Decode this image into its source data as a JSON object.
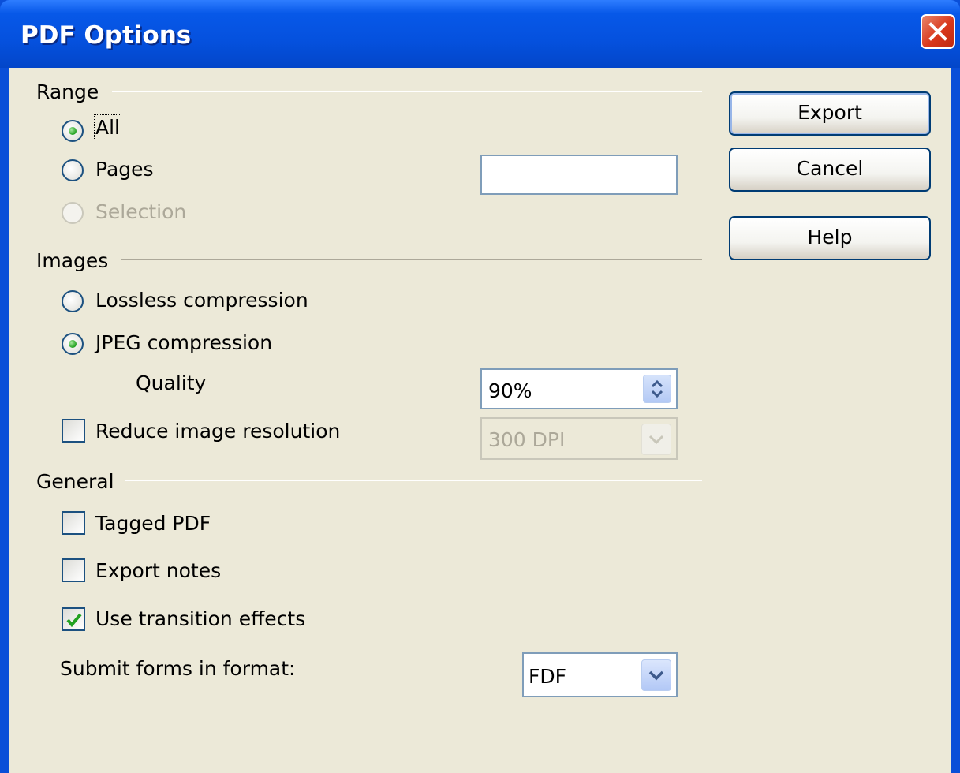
{
  "window": {
    "title": "PDF Options"
  },
  "range": {
    "heading": "Range",
    "all_label": "All",
    "pages_label": "Pages",
    "pages_value": "",
    "selection_label": "Selection",
    "selected": "All"
  },
  "images": {
    "heading": "Images",
    "lossless_label": "Lossless compression",
    "jpeg_label": "JPEG compression",
    "selected": "JPEG compression",
    "quality_label": "Quality",
    "quality_value": "90%",
    "reduce_label": "Reduce image resolution",
    "reduce_checked": false,
    "resolution_value": "300 DPI"
  },
  "general": {
    "heading": "General",
    "tagged_label": "Tagged PDF",
    "tagged_checked": false,
    "notes_label": "Export notes",
    "notes_checked": false,
    "transition_label": "Use transition effects",
    "transition_checked": true,
    "submit_label": "Submit forms in format:",
    "submit_value": "FDF"
  },
  "buttons": {
    "export": "Export",
    "cancel": "Cancel",
    "help": "Help"
  },
  "colors": {
    "title_bar": "#0551de",
    "dialog_bg": "#ece9d8",
    "radio_dot": "#21a121",
    "checkmark": "#21a121"
  }
}
